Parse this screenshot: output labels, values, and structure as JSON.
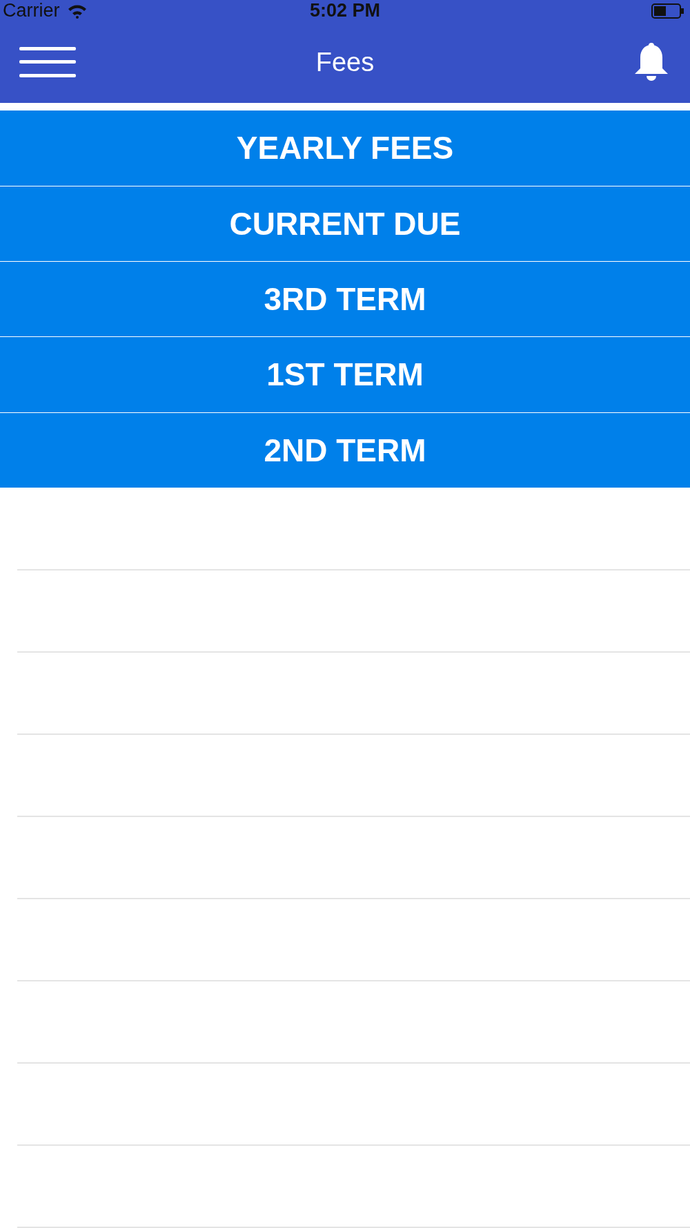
{
  "status_bar": {
    "carrier": "Carrier",
    "time": "5:02 PM"
  },
  "nav_bar": {
    "title": "Fees"
  },
  "menu_items": [
    {
      "label": "YEARLY FEES"
    },
    {
      "label": "CURRENT DUE"
    },
    {
      "label": "3RD TERM"
    },
    {
      "label": "1ST TERM"
    },
    {
      "label": "2ND TERM"
    }
  ]
}
